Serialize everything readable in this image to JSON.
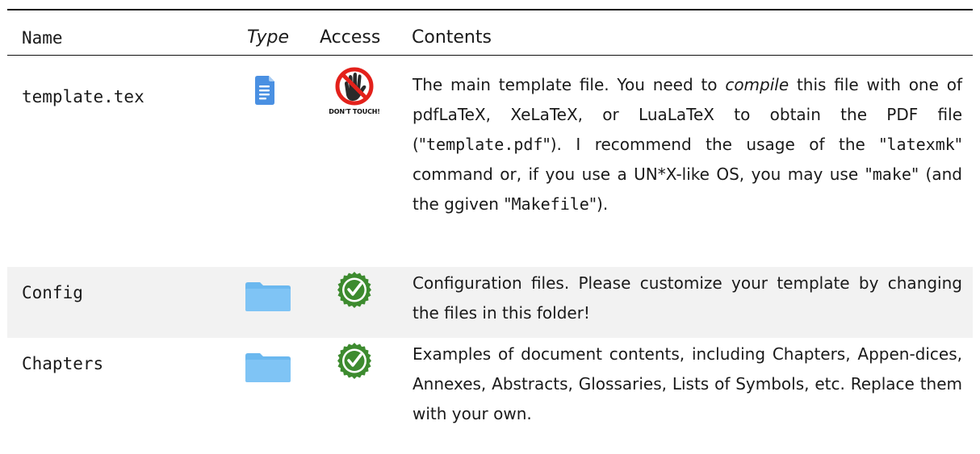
{
  "header": {
    "name": "Name",
    "type": "Type",
    "access": "Access",
    "contents": "Contents"
  },
  "rows": [
    {
      "name": "template.tex",
      "type_icon": "document-icon",
      "access_icon": "dont-touch-icon",
      "access_label": "DON'T TOUCH!",
      "contents": {
        "p1": "The main template file.  You need to ",
        "p2": "compile",
        "p3": " this file with one of pdf",
        "p4": "LaTeX",
        "p5": ", ",
        "p6": "XeLaTeX",
        "p7": ", or Lua",
        "p8": "LaTeX",
        "p9": " to obtain the PDF file (\"",
        "p10": "template.pdf",
        "p11": "\").  I recommend the usage of the \"",
        "p12": "latexmk",
        "p13": "\" command or, if you use a UN*X-like OS, you may use \"",
        "p14": "make",
        "p15": "\" (and the ggiven \"",
        "p16": "Makefile",
        "p17": "\")."
      }
    },
    {
      "name": "Config",
      "type_icon": "folder-icon",
      "access_icon": "allowed-access-icon",
      "access_label": "ALLOWED ACCESS",
      "contents": "Configuration files.  Please customize your template by changing the files in this folder!"
    },
    {
      "name": "Chapters",
      "type_icon": "folder-icon",
      "access_icon": "allowed-access-icon",
      "access_label": "ALLOWED ACCESS",
      "contents": "Examples of document contents, including Chapters, Appen-dices, Annexes, Abstracts, Glossaries, Lists of Symbols, etc. Replace them with your own."
    }
  ],
  "colors": {
    "doc_icon": "#4a90e2",
    "folder": "#7fc4f5",
    "folder_tab": "#6bb8ef",
    "deny_red": "#e3211b",
    "allow_green": "#3d8b2f",
    "row_shade": "#f2f2f2"
  }
}
